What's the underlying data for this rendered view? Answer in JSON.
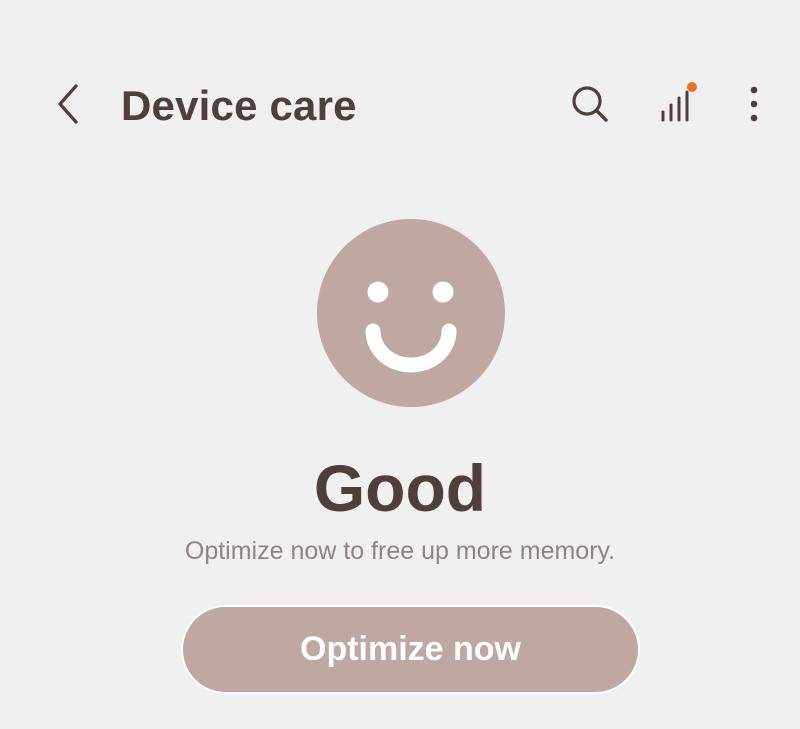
{
  "header": {
    "title": "Device care",
    "back_icon": "chevron-left-icon",
    "search_icon": "search-icon",
    "stats_icon": "bar-chart-icon",
    "more_icon": "more-vertical-icon"
  },
  "status": {
    "icon": "smiley-face-icon",
    "heading": "Good",
    "subtitle": "Optimize now to free up more memory."
  },
  "actions": {
    "optimize_label": "Optimize now"
  },
  "colors": {
    "background": "#f1f0f0",
    "accent": "#bfa7a2",
    "title_text": "#4e3f3c",
    "subtitle_text": "#8d8583",
    "notification_dot": "#e8742a"
  }
}
